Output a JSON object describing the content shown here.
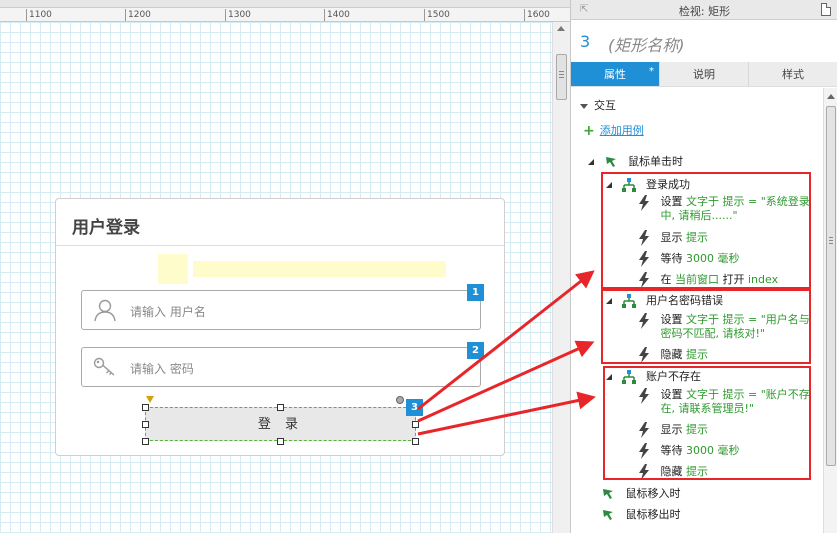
{
  "ruler": {
    "labels": [
      "1100",
      "1200",
      "1300",
      "1400",
      "1500",
      "1600"
    ]
  },
  "login": {
    "title": "用户登录",
    "username_placeholder": "请输入 用户名",
    "password_placeholder": "请输入 密码",
    "button_label": "登 录",
    "badges": [
      "1",
      "2",
      "3"
    ]
  },
  "panel": {
    "title": "检视: 矩形",
    "shape_number": "3",
    "shape_name": "(矩形名称)",
    "tabs": [
      {
        "label": "属性",
        "active": true,
        "star": "*"
      },
      {
        "label": "说明",
        "active": false
      },
      {
        "label": "样式",
        "active": false
      }
    ],
    "section": "交互",
    "add_case": "添加用例",
    "events": [
      {
        "label": "鼠标单击时",
        "cases": [
          {
            "name": "登录成功",
            "actions": [
              {
                "verb": "设置",
                "detail": "文字于 提示 = \"系统登录中, 请稍后......\"",
                "line1": "文字于 提示 = \"系统登录",
                "line2": "中, 请稍后......\""
              },
              {
                "verb": "显示",
                "detail": "提示"
              },
              {
                "verb": "等待",
                "detail": "3000 毫秒"
              },
              {
                "verb": "在",
                "detail": "当前窗口",
                "suffix": "打开",
                "target": "index"
              }
            ]
          },
          {
            "name": "用户名密码错误",
            "actions": [
              {
                "verb": "设置",
                "line1": "文字于 提示 = \"用户名与",
                "line2": "密码不匹配, 请核对!\""
              },
              {
                "verb": "隐藏",
                "detail": "提示"
              }
            ]
          },
          {
            "name": "账户不存在",
            "actions": [
              {
                "verb": "设置",
                "line1": "文字于 提示 = \"账户不存",
                "line2": "在, 请联系管理员!\""
              },
              {
                "verb": "显示",
                "detail": "提示"
              },
              {
                "verb": "等待",
                "detail": "3000 毫秒"
              },
              {
                "verb": "隐藏",
                "detail": "提示"
              }
            ]
          }
        ]
      },
      {
        "label": "鼠标移入时"
      },
      {
        "label": "鼠标移出时"
      }
    ]
  },
  "colors": {
    "accent": "#1f8fd6",
    "action_green": "#2e9a2e",
    "highlight_red": "#e8262a",
    "hint_yellow": "#fffccc"
  }
}
